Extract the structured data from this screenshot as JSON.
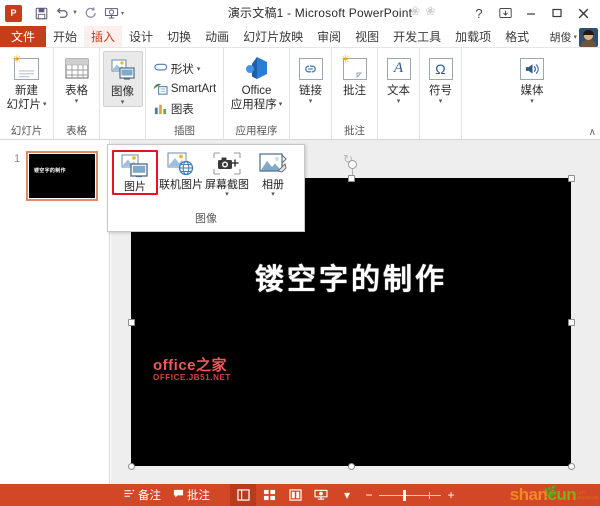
{
  "window": {
    "app_icon": "powerpoint-icon",
    "title": "演示文稿1 - Microsoft PowerPoint",
    "quick_access": [
      {
        "name": "save-icon",
        "glyph": "Ὃe"
      },
      {
        "name": "undo-icon",
        "glyph": "↶"
      },
      {
        "name": "redo-icon",
        "glyph": "↻"
      },
      {
        "name": "start-slideshow-icon",
        "glyph": "⬒"
      }
    ],
    "qat_customize": "≡",
    "controls": {
      "help": "?",
      "ribbon_display": "⬜",
      "minimize": "—",
      "maximize": "□",
      "close": "✕"
    }
  },
  "tabs": {
    "file": "文件",
    "items": [
      {
        "label": "开始",
        "active": false
      },
      {
        "label": "插入",
        "active": true
      },
      {
        "label": "设计",
        "active": false
      },
      {
        "label": "切换",
        "active": false
      },
      {
        "label": "动画",
        "active": false
      },
      {
        "label": "幻灯片放映",
        "active": false
      },
      {
        "label": "审阅",
        "active": false
      },
      {
        "label": "视图",
        "active": false
      },
      {
        "label": "开发工具",
        "active": false
      },
      {
        "label": "加载项",
        "active": false
      },
      {
        "label": "格式",
        "active": false
      }
    ],
    "user_name": "胡俊"
  },
  "ribbon": {
    "groups": [
      {
        "label": "幻灯片",
        "buttons": [
          {
            "label": "新建\n幻灯片",
            "line1": "新建",
            "line2": "幻灯片",
            "has_caret": true
          }
        ]
      },
      {
        "label": "表格",
        "buttons": [
          {
            "line1": "表格",
            "line2": "",
            "has_caret": true
          }
        ]
      },
      {
        "label": "",
        "buttons": [
          {
            "line1": "图像",
            "line2": "",
            "has_caret": true,
            "selected": true
          }
        ]
      },
      {
        "label": "插图",
        "small_buttons": [
          {
            "label": "形状",
            "icon": "shape-icon",
            "has_caret": true
          },
          {
            "label": "SmartArt",
            "icon": "smartart-icon",
            "has_caret": false
          },
          {
            "label": "图表",
            "icon": "chart-icon",
            "has_caret": false
          }
        ]
      },
      {
        "label": "应用程序",
        "buttons": [
          {
            "line1": "Office",
            "line2": "应用程序",
            "has_caret": true
          }
        ]
      },
      {
        "label": "",
        "buttons": [
          {
            "line1": "链接",
            "line2": "",
            "has_caret": true
          }
        ]
      },
      {
        "label": "批注",
        "buttons": [
          {
            "line1": "批注",
            "line2": "",
            "has_caret": false
          }
        ]
      },
      {
        "label": "",
        "buttons": [
          {
            "line1": "文本",
            "line2": "",
            "has_caret": true
          }
        ]
      },
      {
        "label": "",
        "buttons": [
          {
            "line1": "符号",
            "line2": "",
            "has_caret": true
          }
        ]
      },
      {
        "label": "",
        "buttons": [
          {
            "line1": "媒体",
            "line2": "",
            "has_caret": true
          }
        ]
      }
    ],
    "collapse_glyph": "∧"
  },
  "image_menu": {
    "items": [
      {
        "label": "图片",
        "icon": "picture-icon",
        "selected": true,
        "has_caret": false
      },
      {
        "label": "联机图片",
        "icon": "online-picture-icon",
        "selected": false,
        "has_caret": false
      },
      {
        "label": "屏幕截图",
        "icon": "screenshot-camera-icon",
        "selected": false,
        "has_caret": true
      },
      {
        "label": "相册",
        "icon": "photo-album-icon",
        "selected": false,
        "has_caret": true
      }
    ],
    "group_label": "图像"
  },
  "slide_panel": {
    "slides": [
      {
        "number": "1",
        "title": "镂空字的制作"
      }
    ]
  },
  "canvas": {
    "slide_title": "镂空字的制作",
    "watermark_line1": "office之家",
    "watermark_line2": "OFFICE.JB51.NET"
  },
  "status_bar": {
    "notes_label": "备注",
    "notes_icon": "notes-icon",
    "comments_label": "批注",
    "comments_icon": "comment-icon",
    "views": [
      {
        "name": "normal-view",
        "glyph": "▤",
        "active": true
      },
      {
        "name": "slide-sorter-view",
        "glyph": "⬚",
        "active": false
      },
      {
        "name": "reading-view",
        "glyph": "▦",
        "active": false
      },
      {
        "name": "slideshow-view",
        "glyph": "⬒",
        "active": false
      }
    ],
    "more_caret": "▾",
    "zoom_out": "−",
    "zoom_in": "+",
    "brand_a": "shan",
    "brand_b": "cun",
    "brand_tiny_1": "山村",
    "brand_tiny_2": "SHANCUN"
  },
  "colors": {
    "accent": "#c43e1c",
    "status_bar": "#d24726",
    "selection_red": "#e81123",
    "thumb_border": "#e08a6a",
    "slide_bg": "#000000"
  }
}
